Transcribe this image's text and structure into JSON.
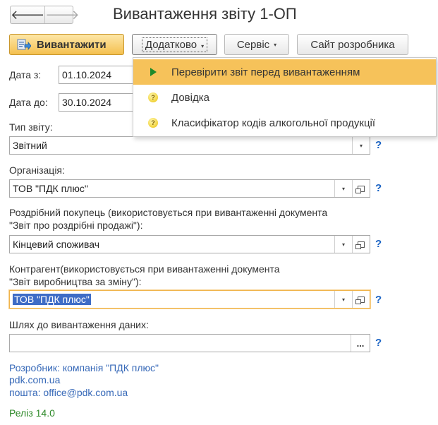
{
  "window": {
    "title": "Вивантаження звіту 1-ОП"
  },
  "nav": {
    "back": "🡐",
    "forward": "🡒"
  },
  "toolbar": {
    "upload": "Вивантажити",
    "extra": "Додатково",
    "service": "Сервіс",
    "site": "Сайт розробника"
  },
  "menu": {
    "items": [
      {
        "label": "Перевірити звіт перед вивантаженням",
        "icon": "play-icon"
      },
      {
        "label": "Довідка",
        "icon": "help-bulb-icon"
      },
      {
        "label": "Класифікатор кодів алкогольної продукції",
        "icon": "help-bulb-icon"
      }
    ]
  },
  "form": {
    "date_from_label": "Дата з:",
    "date_from": "01.10.2024",
    "date_to_label": "Дата до:",
    "date_to": "30.10.2024",
    "report_type_label": "Тип звіту:",
    "report_type": "Звітний",
    "org_label": "Організація:",
    "org": "ТОВ \"ПДК плюс\"",
    "buyer_label_1": "Роздрібний покупець (використовується при вивантаженні документа",
    "buyer_label_2": "\"Звіт про роздрібні продажі\"):",
    "buyer": "Кінцевий споживач",
    "contractor_label_1": "Контрагент(використовується при вивантаженні документа",
    "contractor_label_2": "\"Звіт виробництва за зміну\"):",
    "contractor": "ТОВ \"ПДК плюс\"",
    "path_label": "Шлях до вивантаження даних:",
    "path": "",
    "help": "?",
    "dots": "...",
    "caret": "▾"
  },
  "footer": {
    "developer": "Розробник: компанія \"ПДК плюс\"",
    "site": "pdk.com.ua",
    "mail": "пошта: office@pdk.com.ua",
    "release": "Реліз 14.0"
  }
}
